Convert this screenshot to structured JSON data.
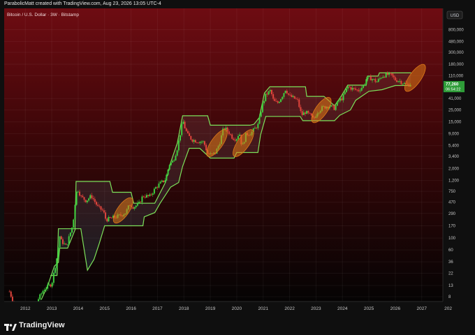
{
  "header": {
    "attribution": "ParabolicMatt created with TradingView.com, Aug 23, 2026 13:05 UTC-4"
  },
  "brand": {
    "name": "TradingView"
  },
  "colors": {
    "band": "#7ce05a",
    "highlight": "#e07a18",
    "up_candle": "#3ecf3e",
    "down_candle": "#e0443c",
    "price_badge": "#2e9d38",
    "bg_top": "#6e0c12",
    "bg_bottom": "#050404"
  },
  "chart_data": {
    "type": "candlestick",
    "title": "Bitcoin / U.S. Dollar · 3W · Bitstamp",
    "currency_button": "USD",
    "y_scale": "log",
    "ylim": [
      6.5,
      2000000
    ],
    "xlim": [
      2011.2,
      2027.8
    ],
    "y_ticks": [
      "800,000",
      "480,000",
      "300,000",
      "180,000",
      "110,000",
      "41,000",
      "25,000",
      "15,000",
      "9,000",
      "5,400",
      "3,400",
      "2,000",
      "1,200",
      "750",
      "470",
      "290",
      "170",
      "100",
      "60",
      "36",
      "22",
      "13",
      "8"
    ],
    "x_ticks": [
      "2012",
      "2013",
      "2014",
      "2015",
      "2016",
      "2017",
      "2018",
      "2019",
      "2020",
      "2021",
      "2022",
      "2023",
      "2024",
      "2025",
      "2026",
      "2027",
      "202"
    ],
    "last_price": "77,260",
    "countdown": "06:54:22",
    "price_path": [
      [
        2011.4,
        10
      ],
      [
        2011.7,
        4
      ],
      [
        2012.0,
        5
      ],
      [
        2012.4,
        6
      ],
      [
        2012.7,
        11
      ],
      [
        2013.0,
        14
      ],
      [
        2013.2,
        45
      ],
      [
        2013.3,
        110
      ],
      [
        2013.35,
        90
      ],
      [
        2013.55,
        70
      ],
      [
        2013.8,
        180
      ],
      [
        2013.92,
        700
      ],
      [
        2014.0,
        800
      ],
      [
        2014.1,
        600
      ],
      [
        2014.3,
        500
      ],
      [
        2014.5,
        620
      ],
      [
        2014.75,
        380
      ],
      [
        2014.95,
        320
      ],
      [
        2015.05,
        220
      ],
      [
        2015.3,
        240
      ],
      [
        2015.55,
        260
      ],
      [
        2015.8,
        300
      ],
      [
        2015.95,
        430
      ],
      [
        2016.1,
        380
      ],
      [
        2016.3,
        440
      ],
      [
        2016.45,
        620
      ],
      [
        2016.7,
        600
      ],
      [
        2016.95,
        900
      ],
      [
        2017.1,
        1050
      ],
      [
        2017.3,
        1250
      ],
      [
        2017.45,
        2400
      ],
      [
        2017.6,
        2800
      ],
      [
        2017.75,
        4800
      ],
      [
        2017.88,
        10000
      ],
      [
        2017.96,
        16000
      ],
      [
        2018.05,
        11000
      ],
      [
        2018.15,
        8500
      ],
      [
        2018.3,
        7000
      ],
      [
        2018.5,
        6500
      ],
      [
        2018.75,
        6300
      ],
      [
        2018.9,
        3800
      ],
      [
        2019.05,
        3600
      ],
      [
        2019.2,
        4000
      ],
      [
        2019.35,
        6000
      ],
      [
        2019.48,
        10500
      ],
      [
        2019.55,
        11500
      ],
      [
        2019.7,
        9500
      ],
      [
        2019.85,
        7500
      ],
      [
        2019.98,
        7200
      ],
      [
        2020.1,
        9500
      ],
      [
        2020.2,
        5000
      ],
      [
        2020.35,
        8800
      ],
      [
        2020.55,
        9300
      ],
      [
        2020.7,
        11500
      ],
      [
        2020.82,
        13500
      ],
      [
        2020.95,
        29000
      ],
      [
        2021.1,
        48000
      ],
      [
        2021.28,
        58000
      ],
      [
        2021.4,
        36000
      ],
      [
        2021.55,
        34000
      ],
      [
        2021.7,
        44000
      ],
      [
        2021.85,
        62000
      ],
      [
        2021.98,
        46000
      ],
      [
        2022.15,
        42000
      ],
      [
        2022.3,
        38000
      ],
      [
        2022.45,
        20000
      ],
      [
        2022.6,
        23000
      ],
      [
        2022.8,
        19500
      ],
      [
        2022.9,
        16500
      ],
      [
        2023.05,
        23000
      ],
      [
        2023.25,
        28000
      ],
      [
        2023.5,
        30000
      ],
      [
        2023.7,
        27000
      ],
      [
        2023.85,
        37000
      ],
      [
        2024.0,
        42000
      ],
      [
        2024.2,
        68000
      ],
      [
        2024.4,
        62000
      ],
      [
        2024.6,
        58000
      ],
      [
        2024.8,
        71000
      ],
      [
        2024.9,
        95000
      ],
      [
        2025.05,
        100000
      ],
      [
        2025.3,
        84000
      ],
      [
        2025.5,
        108000
      ],
      [
        2025.7,
        115000
      ],
      [
        2025.85,
        112000
      ],
      [
        2026.0,
        92000
      ],
      [
        2026.15,
        88000
      ],
      [
        2026.3,
        80000
      ],
      [
        2026.45,
        74000
      ],
      [
        2026.6,
        77260
      ]
    ],
    "band_upper": [
      [
        2012.95,
        20
      ],
      [
        2013.2,
        20
      ],
      [
        2013.25,
        150
      ],
      [
        2013.88,
        150
      ],
      [
        2013.92,
        1150
      ],
      [
        2015.2,
        1150
      ],
      [
        2015.3,
        720
      ],
      [
        2016.0,
        720
      ],
      [
        2016.1,
        450
      ],
      [
        2016.9,
        450
      ],
      [
        2017.3,
        1100
      ],
      [
        2017.5,
        2600
      ],
      [
        2017.75,
        6000
      ],
      [
        2017.95,
        19500
      ],
      [
        2018.9,
        19500
      ],
      [
        2019.0,
        13000
      ],
      [
        2019.5,
        13000
      ],
      [
        2020.5,
        13000
      ],
      [
        2020.65,
        13500
      ],
      [
        2020.85,
        18000
      ],
      [
        2021.05,
        52000
      ],
      [
        2021.25,
        68000
      ],
      [
        2022.6,
        68000
      ],
      [
        2022.65,
        45000
      ],
      [
        2023.3,
        45000
      ],
      [
        2023.7,
        30000
      ],
      [
        2023.95,
        45000
      ],
      [
        2024.2,
        73000
      ],
      [
        2024.9,
        73000
      ],
      [
        2024.95,
        108000
      ],
      [
        2025.35,
        108000
      ],
      [
        2025.4,
        124000
      ],
      [
        2026.6,
        124000
      ]
    ],
    "band_lower": [
      [
        2012.6,
        7
      ],
      [
        2012.85,
        13
      ],
      [
        2013.1,
        30
      ],
      [
        2013.25,
        35
      ],
      [
        2013.3,
        65
      ],
      [
        2013.6,
        65
      ],
      [
        2013.9,
        150
      ],
      [
        2014.1,
        150
      ],
      [
        2014.35,
        25
      ],
      [
        2014.6,
        40
      ],
      [
        2014.8,
        80
      ],
      [
        2015.0,
        170
      ],
      [
        2016.45,
        170
      ],
      [
        2016.5,
        250
      ],
      [
        2016.9,
        300
      ],
      [
        2017.1,
        450
      ],
      [
        2017.5,
        900
      ],
      [
        2017.8,
        1100
      ],
      [
        2017.95,
        2200
      ],
      [
        2018.2,
        4800
      ],
      [
        2018.6,
        4800
      ],
      [
        2019.0,
        3150
      ],
      [
        2019.9,
        3150
      ],
      [
        2020.0,
        4000
      ],
      [
        2020.8,
        4000
      ],
      [
        2020.9,
        8500
      ],
      [
        2021.1,
        19000
      ],
      [
        2022.4,
        19000
      ],
      [
        2022.5,
        15800
      ],
      [
        2023.7,
        15800
      ],
      [
        2023.9,
        20000
      ],
      [
        2024.3,
        25000
      ],
      [
        2024.5,
        38000
      ],
      [
        2025.0,
        56000
      ],
      [
        2025.5,
        60000
      ],
      [
        2026.0,
        72000
      ],
      [
        2026.6,
        72000
      ]
    ],
    "highlights": [
      {
        "x": 2015.7,
        "y": 330,
        "rx_years": 0.22,
        "ry_decades": 0.28,
        "angle": 35
      },
      {
        "x": 2019.25,
        "y": 6000,
        "rx_years": 0.22,
        "ry_decades": 0.3,
        "angle": 35
      },
      {
        "x": 2020.25,
        "y": 6000,
        "rx_years": 0.22,
        "ry_decades": 0.3,
        "angle": 35
      },
      {
        "x": 2023.2,
        "y": 25000,
        "rx_years": 0.22,
        "ry_decades": 0.28,
        "angle": 35
      },
      {
        "x": 2026.75,
        "y": 100000,
        "rx_years": 0.22,
        "ry_decades": 0.3,
        "angle": 35
      }
    ]
  }
}
